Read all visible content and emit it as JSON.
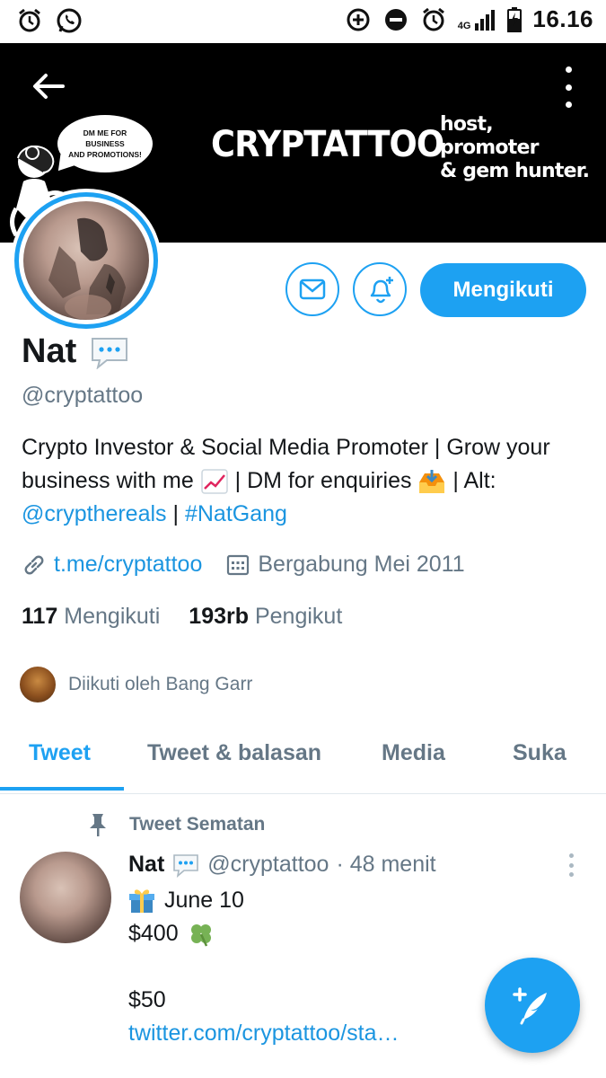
{
  "status_bar": {
    "time": "16.16",
    "network": "4G"
  },
  "banner": {
    "brand": "CRYPTATTOO",
    "tagline_lines": [
      "host,",
      "promoter",
      "& gem hunter."
    ],
    "bubble_lines": [
      "DM ME FOR BUSINESS",
      "AND PROMOTIONS!"
    ],
    "background_color": "#000000"
  },
  "actions": {
    "follow_label": "Mengikuti"
  },
  "profile": {
    "name": "Nat",
    "handle": "@cryptattoo",
    "bio_part1": "Crypto Investor & Social Media Promoter | Grow your business with me",
    "bio_part2": " | DM for enquiries",
    "bio_part3": " | Alt: ",
    "bio_mention": "@crypthereals",
    "bio_sep": " | ",
    "bio_hashtag": "#NatGang",
    "link": "t.me/cryptattoo",
    "joined": "Bergabung Mei 2011",
    "following_count": "117",
    "following_label": "Mengikuti",
    "followers_count": "193rb",
    "followers_label": "Pengikut",
    "followed_by": "Diikuti oleh Bang Garr"
  },
  "tabs": [
    {
      "label": "Tweet",
      "active": true
    },
    {
      "label": "Tweet & balasan",
      "active": false
    },
    {
      "label": "Media",
      "active": false
    },
    {
      "label": "Suka",
      "active": false
    }
  ],
  "pinned_tweet": {
    "pinned_label": "Tweet Sematan",
    "name": "Nat",
    "handle": "@cryptattoo",
    "time": "· 48 menit",
    "line1": "June 10",
    "line2": "$400",
    "line3": "$50",
    "link": "twitter.com/cryptattoo/sta…"
  },
  "colors": {
    "accent": "#1da1f2",
    "link": "#1b95e0",
    "secondary_text": "#657786"
  }
}
